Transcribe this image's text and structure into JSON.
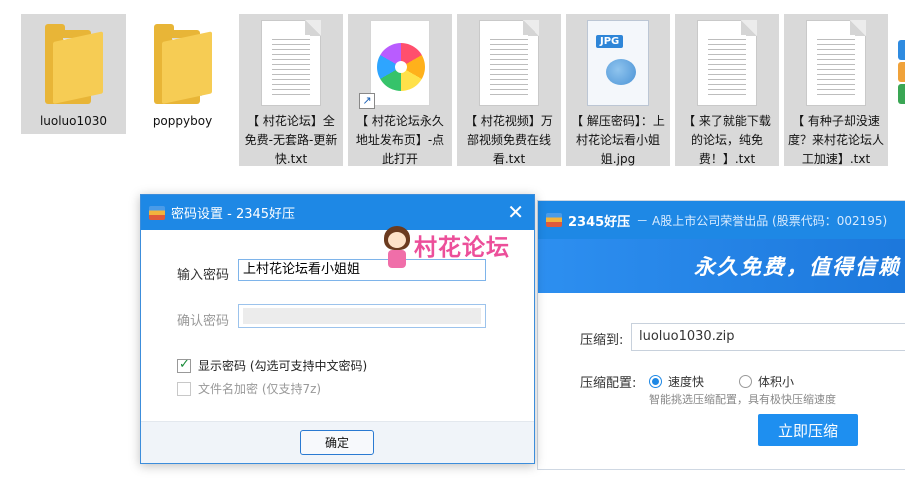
{
  "explorer": {
    "items": [
      {
        "name": "luoluo1030",
        "icon": "folder-icon"
      },
      {
        "name": "poppyboy",
        "icon": "folder-icon"
      },
      {
        "name": "【 村花论坛】全免费-无套路-更新快.txt",
        "icon": "text-file-icon"
      },
      {
        "name": "【 村花论坛永久地址发布页】-点此打开",
        "icon": "browser-shortcut-icon"
      },
      {
        "name": "【 村花视频】万部视频免费在线看.txt",
        "icon": "text-file-icon"
      },
      {
        "name": "【 解压密码】：上村花论坛看小姐姐.jpg",
        "icon": "jpg-file-icon"
      },
      {
        "name": "【 来了就能下载的论坛，纯免费！】.txt",
        "icon": "text-file-icon"
      },
      {
        "name": "【 有种子却没速度？来村花论坛人工加速】.txt",
        "icon": "text-file-icon"
      }
    ],
    "jpg_badge": "JPG",
    "shortcut_arrow": "↗"
  },
  "password_dialog": {
    "title": "密码设置 - 2345好压",
    "close": "✕",
    "enter_label": "输入密码",
    "enter_value": "上村花论坛看小姐姐",
    "confirm_label": "确认密码",
    "show_password_label": "显示密码 (勾选可支持中文密码)",
    "show_password_checked": true,
    "encrypt_names_label": "文件名加密  (仅支持7z)",
    "encrypt_names_checked": false,
    "ok_label": "确定"
  },
  "watermark": {
    "text": "村花论坛"
  },
  "compressor": {
    "brand": "2345好压",
    "subtitle": "－ A股上市公司荣誉出品 (股票代码：002195)",
    "slogan": "永久免费，值得信赖",
    "dest_label": "压缩到:",
    "dest_value": "luoluo1030.zip",
    "config_label": "压缩配置:",
    "option_fast": "速度快",
    "option_small": "体积小",
    "selected_option": "速度快",
    "hint": "智能挑选压缩配置，具有极快压缩速度",
    "compress_button": "立即压缩"
  },
  "colors": {
    "title_bar": "#1e88e5",
    "selection": "#d9d9d9",
    "watermark": "#ec4f9a",
    "accent_button": "#1e8ff0"
  }
}
